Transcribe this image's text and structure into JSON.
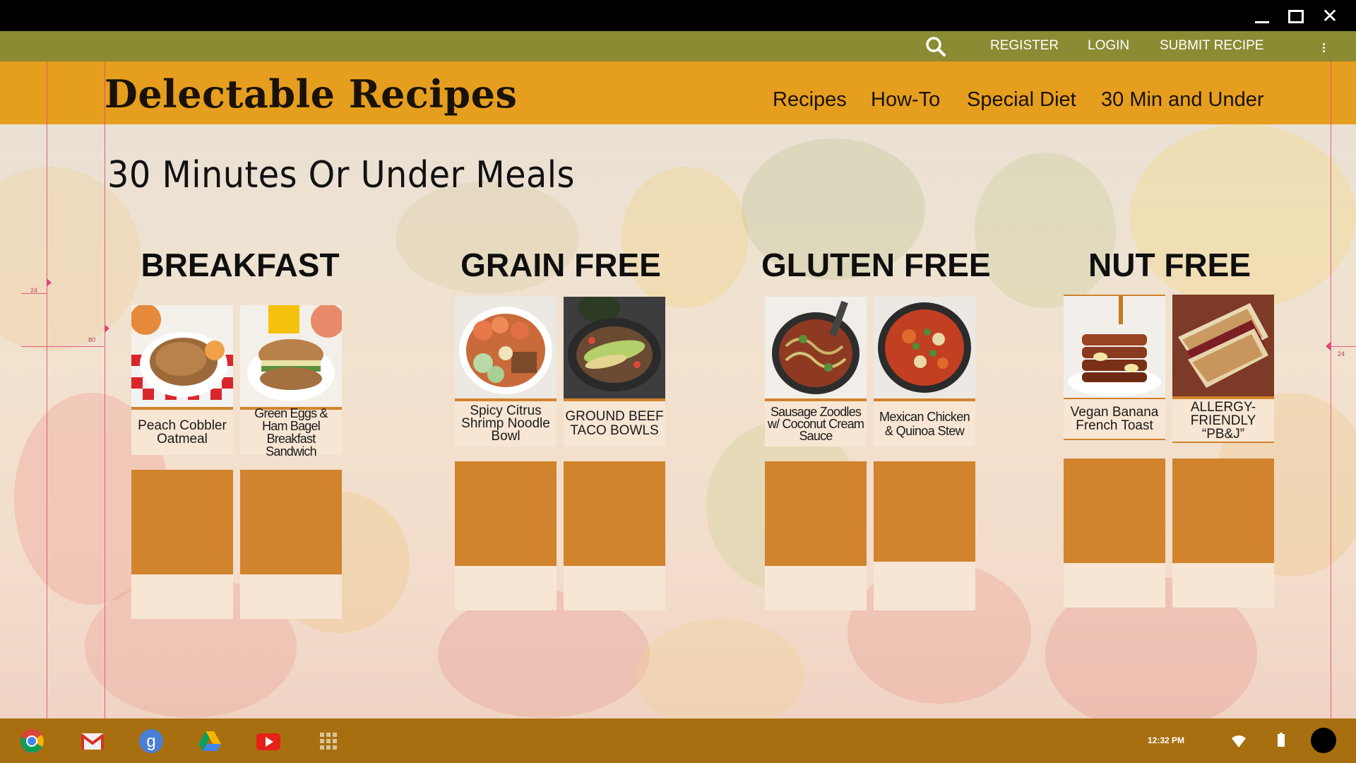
{
  "window": {
    "minimize_icon": "minimize-icon",
    "maximize_icon": "maximize-icon",
    "close_icon": "close-icon",
    "close_glyph": "✕"
  },
  "utility_bar": {
    "search_icon": "search-icon",
    "register": "REGISTER",
    "login": "LOGIN",
    "submit_recipe": "SUBMIT RECIPE",
    "more_icon": "more-vert-icon"
  },
  "header": {
    "site_title": "Delectable Recipes",
    "nav": [
      "Recipes",
      "How-To",
      "Special Diet",
      "30 Min and Under"
    ]
  },
  "page": {
    "heading": "30 Minutes Or Under Meals"
  },
  "categories": [
    {
      "title": "BREAKFAST",
      "cards": [
        {
          "label": "Peach Cobbler Oatmeal"
        },
        {
          "label": "Green Eggs & Ham Bagel Breakfast Sandwich"
        }
      ]
    },
    {
      "title": "GRAIN FREE",
      "cards": [
        {
          "label": "Spicy Citrus Shrimp Noodle Bowl"
        },
        {
          "label": "GROUND BEEF TACO BOWLS"
        }
      ]
    },
    {
      "title": "GLUTEN FREE",
      "cards": [
        {
          "label": "Sausage Zoodles w/ Coconut Cream Sauce"
        },
        {
          "label": "Mexican Chicken & Quinoa Stew"
        }
      ]
    },
    {
      "title": "NUT FREE",
      "cards": [
        {
          "label": "Vegan Banana French Toast"
        },
        {
          "label": "ALLERGY-FRIENDLY “PB&J”"
        }
      ]
    }
  ],
  "guides": {
    "label_24": "24",
    "label_80": "80",
    "label_24_right": "24"
  },
  "taskbar": {
    "apps": [
      "chrome-icon",
      "gmail-icon",
      "google-search-icon",
      "drive-icon",
      "youtube-icon",
      "app-launcher-icon"
    ],
    "time": "12:32 PM"
  },
  "colors": {
    "titlebar": "#000000",
    "utility_bar": "#8b8b34",
    "header": "#e59e1e",
    "card_accent": "#d1832d",
    "card_label_bg": "#f6e6d3",
    "taskbar": "#a86f10"
  }
}
